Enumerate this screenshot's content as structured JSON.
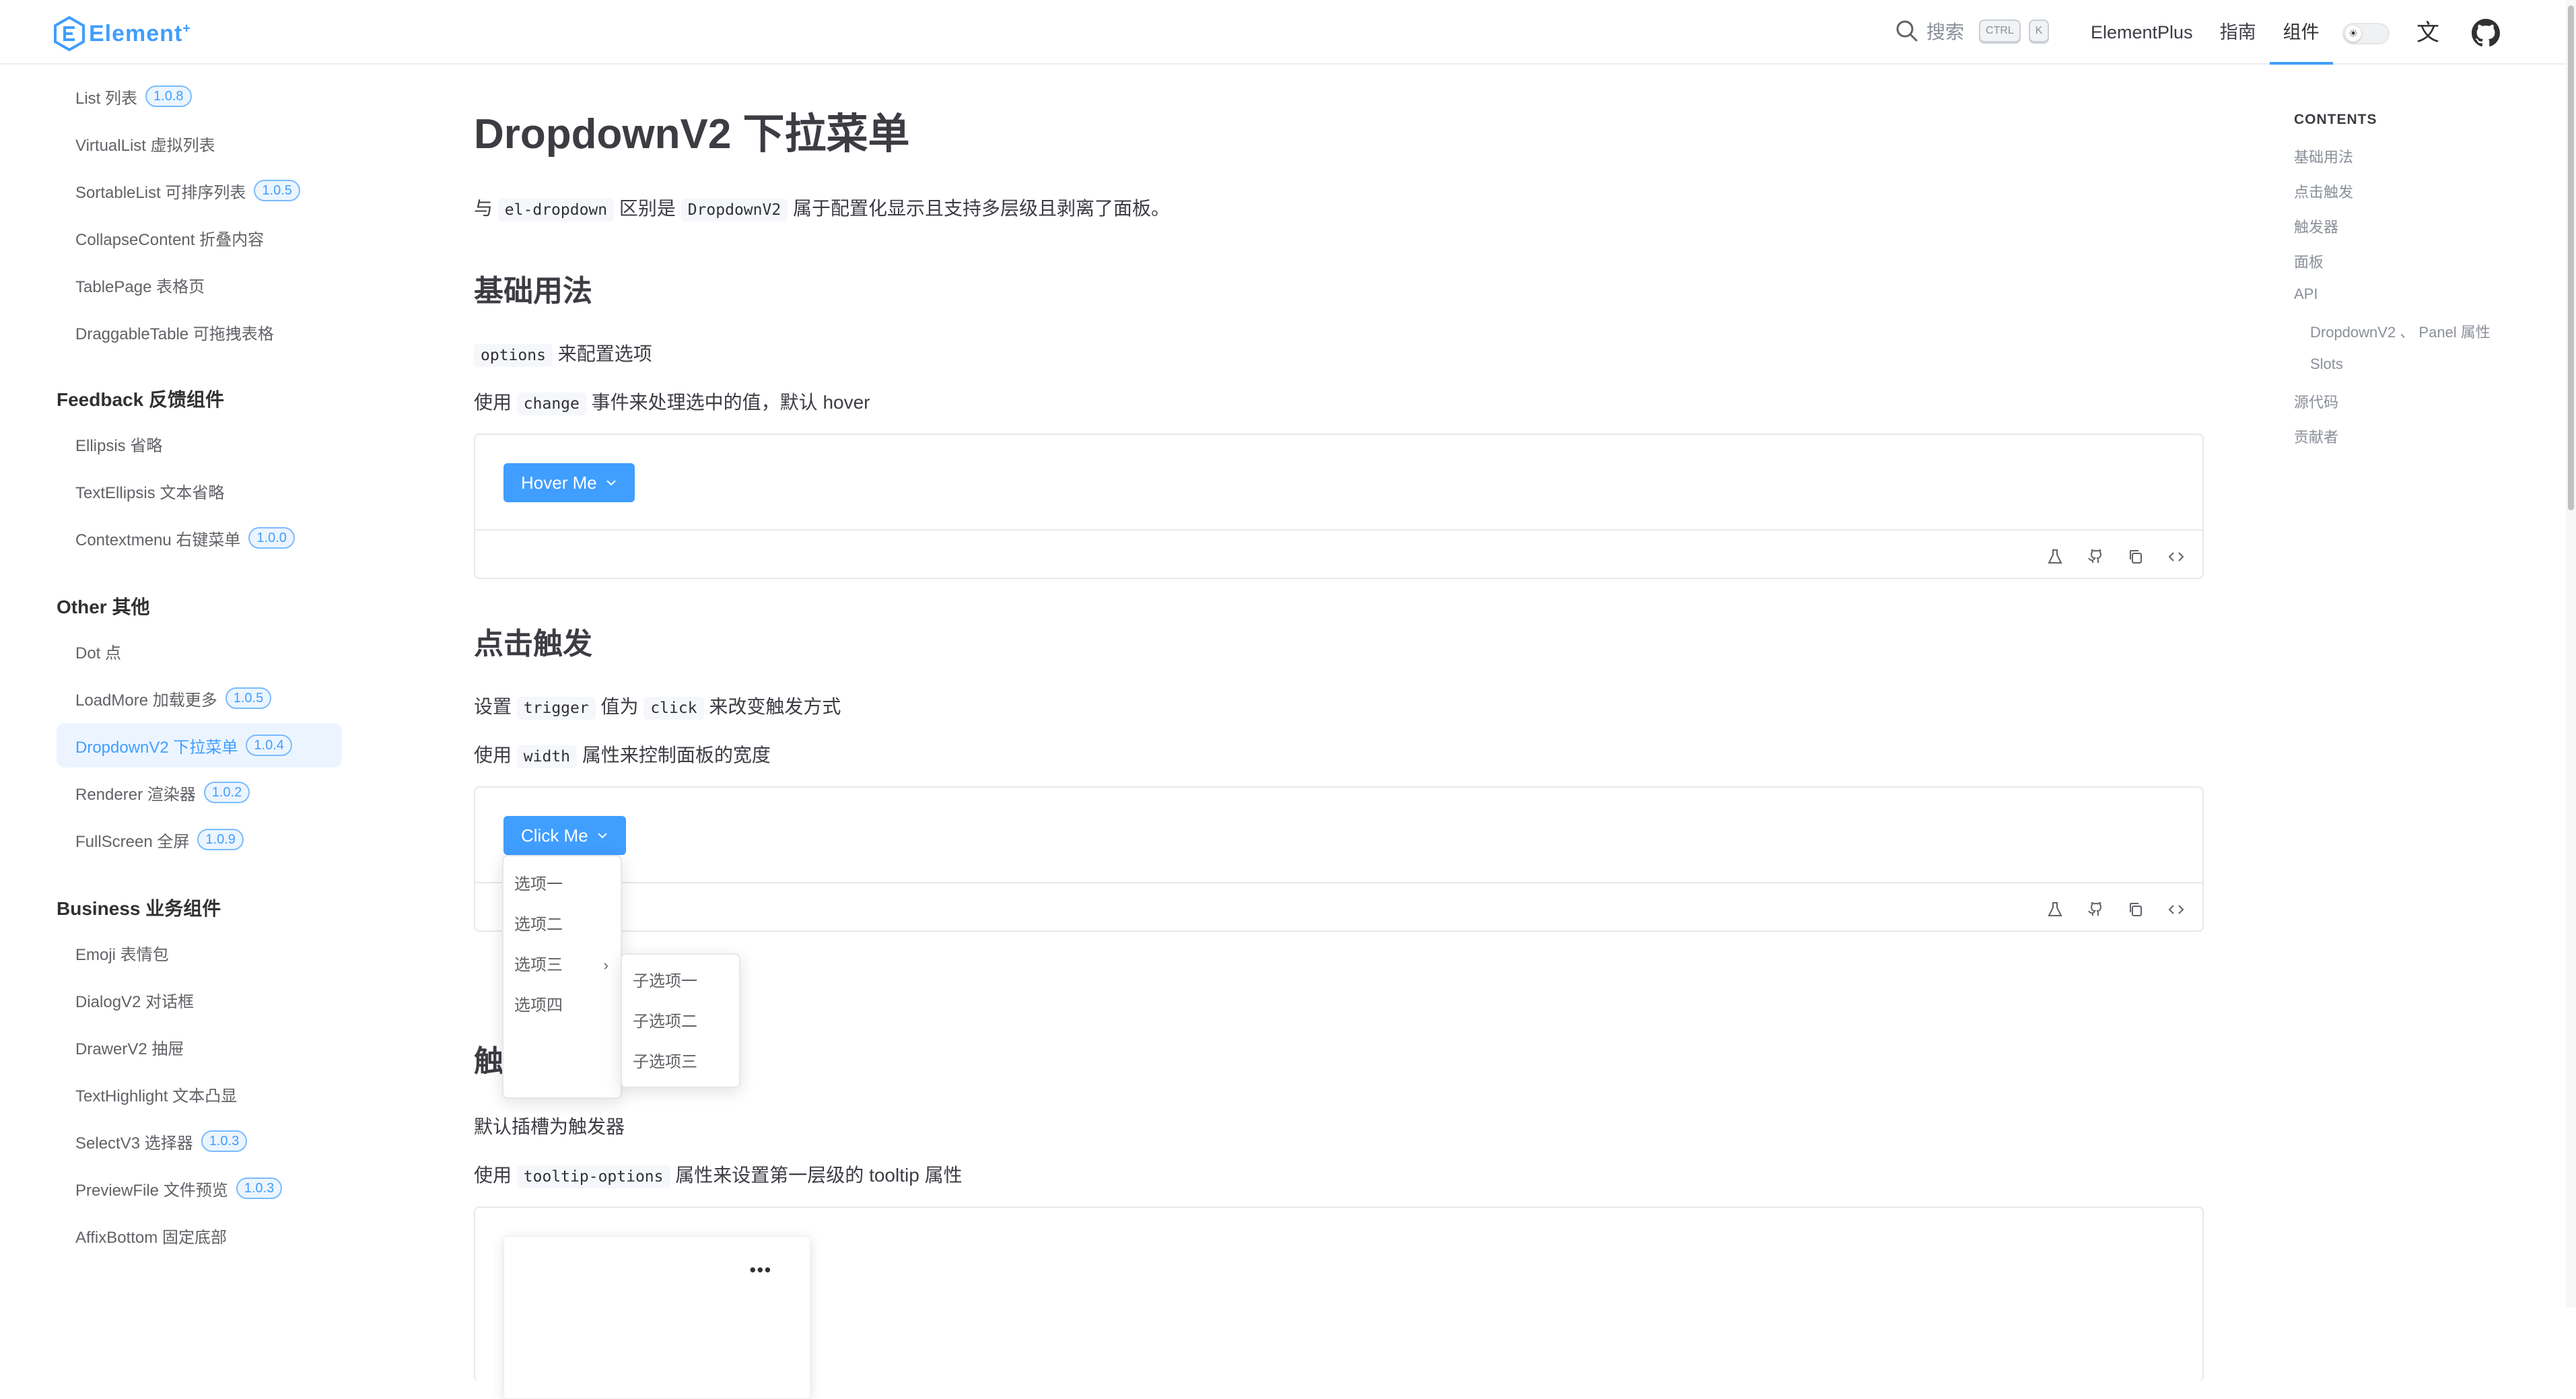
{
  "navbar": {
    "logo_text": "Element",
    "logo_sup": "+",
    "search_label": "搜索",
    "search_keys": [
      "CTRL",
      "K"
    ],
    "links": [
      "ElementPlus",
      "指南",
      "组件"
    ],
    "active_link": "组件"
  },
  "sidebar": {
    "items_top": [
      {
        "label": "List 列表",
        "badge": "1.0.8"
      },
      {
        "label": "VirtualList 虚拟列表",
        "badge": null
      },
      {
        "label": "SortableList 可排序列表",
        "badge": "1.0.5"
      },
      {
        "label": "CollapseContent 折叠内容",
        "badge": null
      },
      {
        "label": "TablePage 表格页",
        "badge": null
      },
      {
        "label": "DraggableTable 可拖拽表格",
        "badge": null
      }
    ],
    "group_feedback": "Feedback 反馈组件",
    "items_feedback": [
      {
        "label": "Ellipsis 省略",
        "badge": null
      },
      {
        "label": "TextEllipsis 文本省略",
        "badge": null
      },
      {
        "label": "Contextmenu 右键菜单",
        "badge": "1.0.0"
      }
    ],
    "group_other": "Other 其他",
    "items_other": [
      {
        "label": "Dot 点",
        "badge": null
      },
      {
        "label": "LoadMore 加载更多",
        "badge": "1.0.5"
      },
      {
        "label": "DropdownV2 下拉菜单",
        "badge": "1.0.4"
      },
      {
        "label": "Renderer 渲染器",
        "badge": "1.0.2"
      },
      {
        "label": "FullScreen 全屏",
        "badge": "1.0.9"
      }
    ],
    "group_business": "Business 业务组件",
    "items_business": [
      {
        "label": "Emoji 表情包",
        "badge": null
      },
      {
        "label": "DialogV2 对话框",
        "badge": null
      },
      {
        "label": "DrawerV2 抽屉",
        "badge": null
      },
      {
        "label": "TextHighlight 文本凸显",
        "badge": null
      },
      {
        "label": "SelectV3 选择器",
        "badge": "1.0.3"
      },
      {
        "label": "PreviewFile 文件预览",
        "badge": "1.0.3"
      },
      {
        "label": "AffixBottom 固定底部",
        "badge": null
      }
    ]
  },
  "main": {
    "title": "DropdownV2 下拉菜单",
    "intro": {
      "pre": "与",
      "code1": "el-dropdown",
      "mid": "区别是",
      "code2": "DropdownV2",
      "post": "属于配置化显示且支持多层级且剥离了面板。"
    },
    "s1": {
      "heading": "基础用法",
      "p1": {
        "code": "options",
        "text": "来配置选项"
      },
      "p2": {
        "pre": "使用",
        "code": "change",
        "post": "事件来处理选中的值，默认 hover"
      },
      "button": "Hover Me"
    },
    "s2": {
      "heading": "点击触发",
      "p1": {
        "pre": "设置",
        "code1": "trigger",
        "mid": "值为",
        "code2": "click",
        "post": "来改变触发方式"
      },
      "p2": {
        "pre": "使用",
        "code": "width",
        "post": "属性来控制面板的宽度"
      },
      "button": "Click Me",
      "menu": [
        "选项一",
        "选项二",
        "选项三",
        "选项四"
      ],
      "submenu": [
        "子选项一",
        "子选项二",
        "子选项三"
      ]
    },
    "s3": {
      "heading_visible": "触",
      "p1": "默认插槽为触发器",
      "p2": {
        "pre": "使用",
        "code": "tooltip-options",
        "post": "属性来设置第一层级的 tooltip 属性"
      },
      "dots": "•••"
    }
  },
  "toc": {
    "title": "CONTENTS",
    "items": [
      "基础用法",
      "点击触发",
      "触发器",
      "面板",
      "API",
      "DropdownV2 、 Panel 属性",
      "Slots",
      "源代码",
      "贡献者"
    ]
  },
  "colors": {
    "primary": "#409eff",
    "text": "#303133",
    "muted": "#8a8f99",
    "border": "#e4e7ed"
  }
}
